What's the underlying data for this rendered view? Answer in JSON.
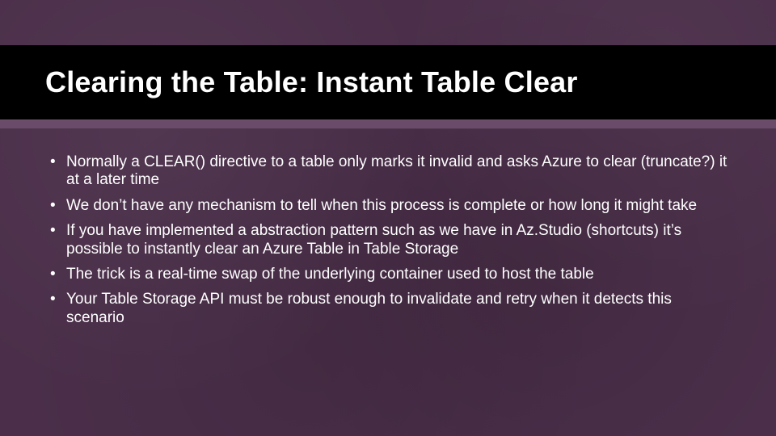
{
  "slide": {
    "title": "Clearing the Table: Instant Table Clear",
    "bullets": [
      "Normally a CLEAR() directive to a table only marks it invalid and asks Azure to clear (truncate?) it at a later time",
      "We don’t have any mechanism to tell when this process is complete or how long it might take",
      "If you have implemented a abstraction pattern such as we have in Az.Studio (shortcuts) it’s possible to instantly clear an Azure Table in Table Storage",
      "The trick is a real-time swap of the underlying container used to host the table",
      "Your Table Storage API must be robust enough to invalidate and retry when it detects this scenario"
    ]
  }
}
